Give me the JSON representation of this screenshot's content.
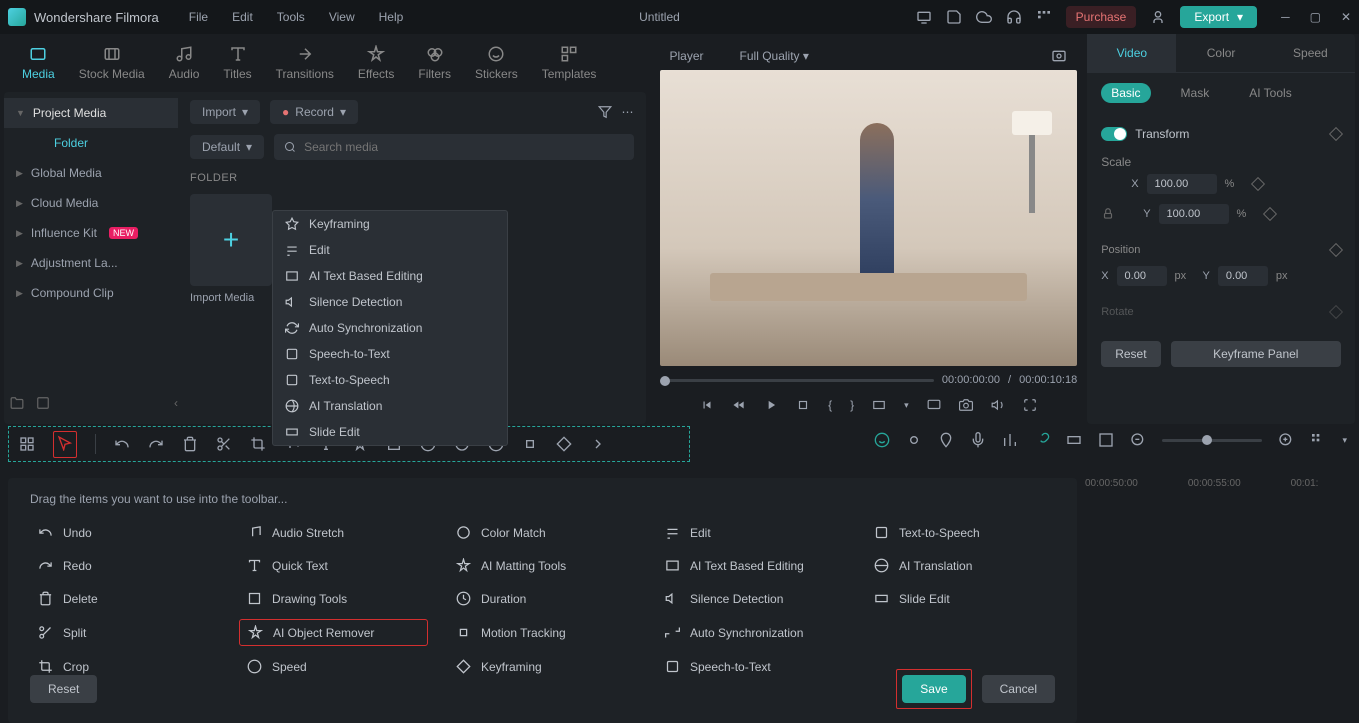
{
  "titlebar": {
    "app_name": "Wondershare Filmora",
    "menus": [
      "File",
      "Edit",
      "Tools",
      "View",
      "Help"
    ],
    "doc_title": "Untitled",
    "purchase": "Purchase",
    "export": "Export"
  },
  "asset_tabs": [
    "Media",
    "Stock Media",
    "Audio",
    "Titles",
    "Transitions",
    "Effects",
    "Filters",
    "Stickers",
    "Templates"
  ],
  "sidebar": {
    "items": [
      {
        "label": "Project Media",
        "sel": true
      },
      {
        "label": "Folder",
        "sub": true
      },
      {
        "label": "Global Media"
      },
      {
        "label": "Cloud Media"
      },
      {
        "label": "Influence Kit",
        "badge": "NEW"
      },
      {
        "label": "Adjustment La..."
      },
      {
        "label": "Compound Clip"
      }
    ]
  },
  "media_pane": {
    "import": "Import",
    "record": "Record",
    "default": "Default",
    "search_placeholder": "Search media",
    "folder_label": "FOLDER",
    "import_media": "Import Media"
  },
  "context_menu": [
    "Keyframing",
    "Edit",
    "AI Text Based Editing",
    "Silence Detection",
    "Auto Synchronization",
    "Speech-to-Text",
    "Text-to-Speech",
    "AI Translation",
    "Slide Edit"
  ],
  "player": {
    "label": "Player",
    "quality": "Full Quality",
    "time_current": "00:00:00:00",
    "time_total": "00:00:10:18"
  },
  "inspector": {
    "tabs": [
      "Video",
      "Color",
      "Speed"
    ],
    "sub_tabs": [
      "Basic",
      "Mask",
      "AI Tools"
    ],
    "transform": "Transform",
    "scale": "Scale",
    "scale_x": "100.00",
    "scale_y": "100.00",
    "position": "Position",
    "pos_x": "0.00",
    "pos_y": "0.00",
    "rotate": "Rotate",
    "reset": "Reset",
    "keyframe_panel": "Keyframe Panel",
    "x": "X",
    "y": "Y",
    "pct": "%",
    "px": "px"
  },
  "customize": {
    "hint": "Drag the items you want to use into the toolbar...",
    "items": [
      "Undo",
      "Audio Stretch",
      "Color Match",
      "Edit",
      "Text-to-Speech",
      "Redo",
      "Quick Text",
      "AI Matting Tools",
      "AI Text Based Editing",
      "AI Translation",
      "Delete",
      "Drawing Tools",
      "Duration",
      "Silence Detection",
      "Slide Edit",
      "Split",
      "AI Object Remover",
      "Motion Tracking",
      "Auto Synchronization",
      "",
      "Crop",
      "Speed",
      "Keyframing",
      "Speech-to-Text",
      ""
    ],
    "reset": "Reset",
    "save": "Save",
    "cancel": "Cancel"
  },
  "timeline": {
    "marks": [
      "00:00:50:00",
      "00:00:55:00",
      "00:01:"
    ]
  }
}
